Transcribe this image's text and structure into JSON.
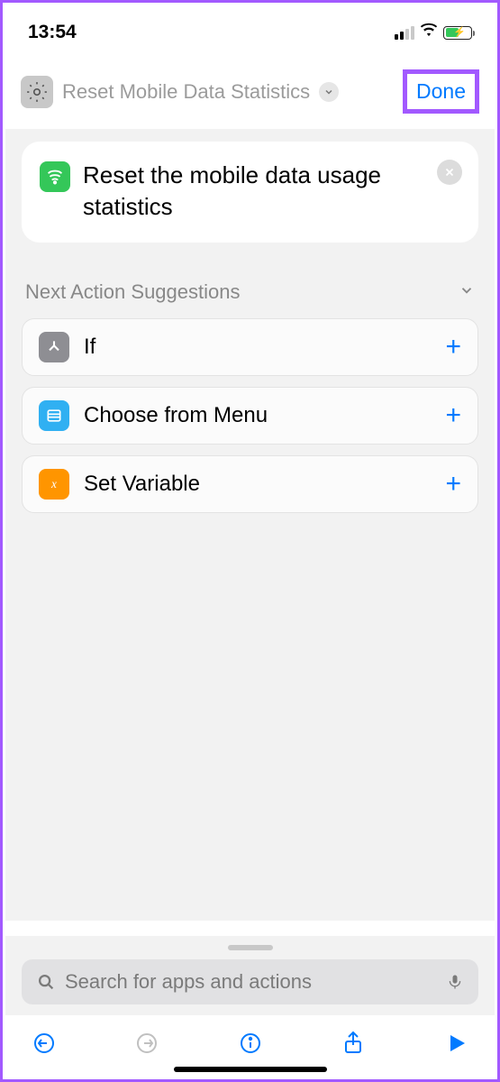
{
  "statusBar": {
    "time": "13:54"
  },
  "navBar": {
    "title": "Reset Mobile Data Statistics",
    "doneLabel": "Done"
  },
  "action": {
    "text": "Reset the mobile data usage statistics"
  },
  "suggestions": {
    "header": "Next Action Suggestions",
    "items": [
      {
        "label": "If"
      },
      {
        "label": "Choose from Menu"
      },
      {
        "label": "Set Variable"
      }
    ]
  },
  "search": {
    "placeholder": "Search for apps and actions"
  },
  "colors": {
    "accent": "#007aff",
    "green": "#34c759",
    "orange": "#ff9500",
    "blue": "#30b0f2",
    "gray": "#8e8e93",
    "highlight": "#a259ff"
  }
}
